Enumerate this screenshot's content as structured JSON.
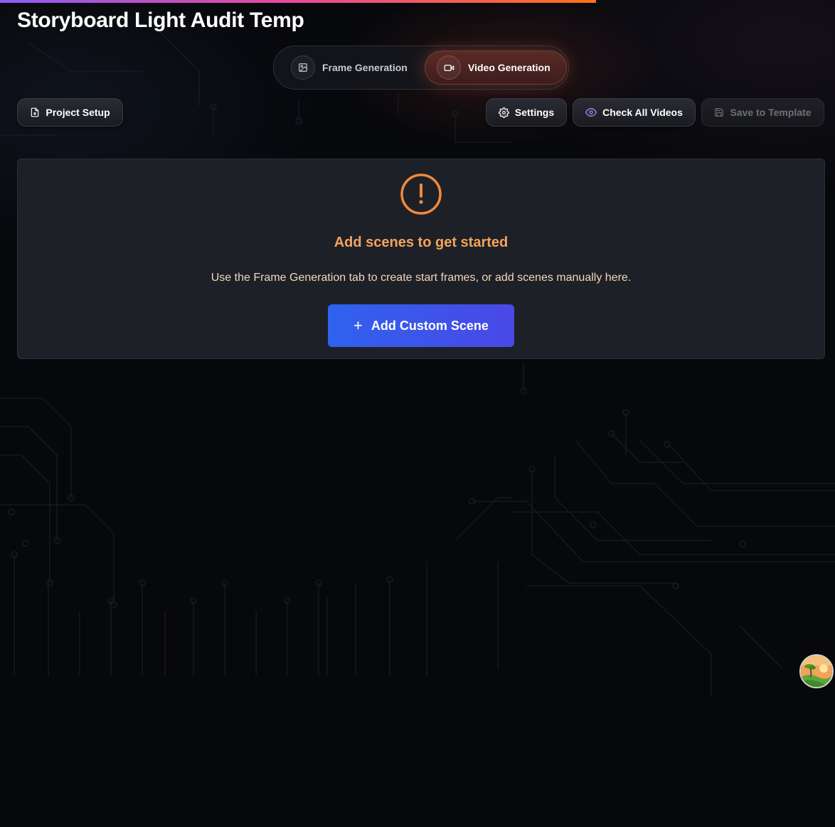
{
  "page": {
    "title": "Storyboard Light Audit Temp"
  },
  "tabs": [
    {
      "label": "Frame Generation",
      "icon": "image-icon",
      "active": false
    },
    {
      "label": "Video Generation",
      "icon": "video-camera-icon",
      "active": true
    }
  ],
  "toolbar": {
    "project_setup": "Project Setup",
    "settings": "Settings",
    "check_all_videos": "Check All Videos",
    "save_to_template": "Save to Template"
  },
  "empty_state": {
    "icon": "alert-circle-icon",
    "title": "Add scenes to get started",
    "description": "Use the Frame Generation tab to create start frames, or add scenes manually here.",
    "button_label": "Add Custom Scene"
  },
  "colors": {
    "accent_orange": "#f6a35c",
    "primary_button": "#3b5bea",
    "active_tab": "#4a2321",
    "background": "#07080c"
  }
}
